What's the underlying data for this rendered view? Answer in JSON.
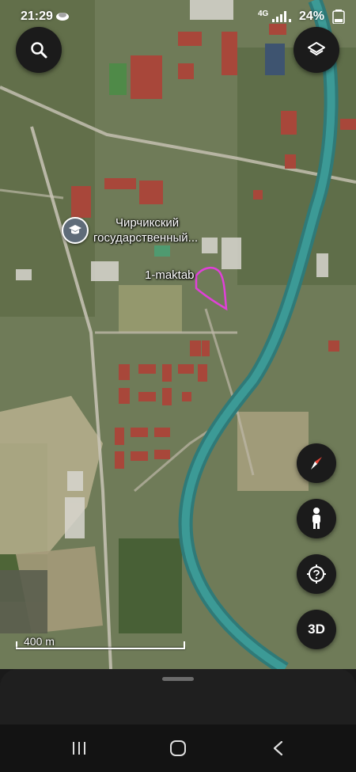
{
  "status_bar": {
    "time": "21:29",
    "network": "4G",
    "battery": "24%"
  },
  "map": {
    "poi_university_line1": "Чирчикский",
    "poi_university_line2": "государственный...",
    "poi_school": "1-maktab",
    "scale_label": "400 m",
    "poi_university_icon": "graduation-cap-icon",
    "highlight_color": "#e040d8"
  },
  "controls": {
    "search_icon": "search-icon",
    "layers_icon": "layers-icon",
    "compass_icon": "compass-icon",
    "pegman_icon": "pegman-icon",
    "locate_icon": "locate-icon",
    "threed_label": "3D"
  },
  "navigation_bar": {
    "recents_icon": "recents-icon",
    "home_icon": "home-icon",
    "back_icon": "back-icon"
  }
}
